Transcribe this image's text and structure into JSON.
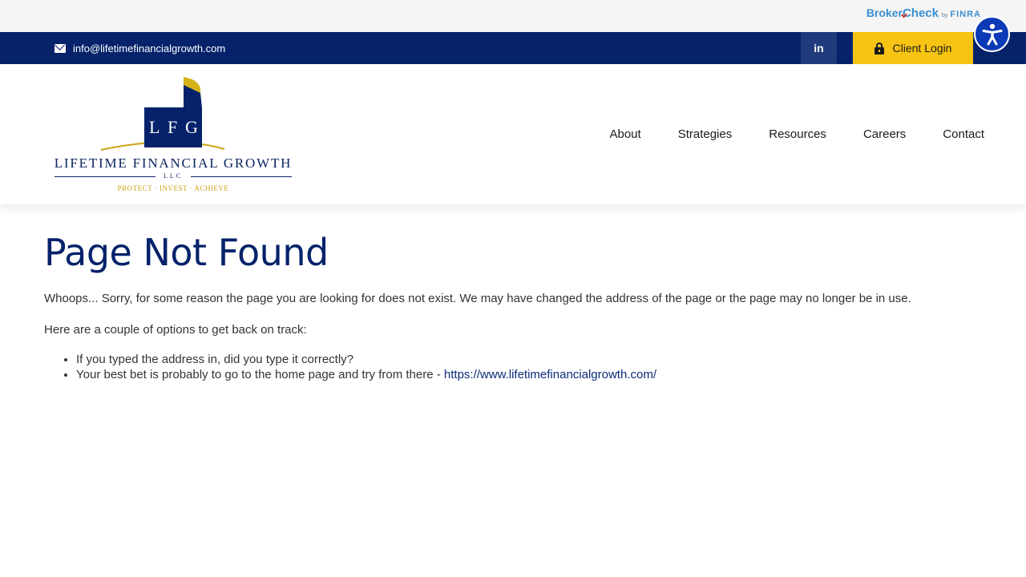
{
  "brokercheck": {
    "broker": "Broker",
    "check": "Check",
    "by": "by",
    "finra": "FINRA"
  },
  "topbar": {
    "email": "info@lifetimefinancialgrowth.com",
    "linkedin_label": "in",
    "client_login": "Client Login"
  },
  "logo": {
    "letters": [
      "L",
      "F",
      "G"
    ],
    "name": "LIFETIME FINANCIAL GROWTH",
    "llc": "LLC",
    "tagline": "PROTECT · INVEST · ACHIEVE"
  },
  "nav": {
    "items": [
      "About",
      "Strategies",
      "Resources",
      "Careers",
      "Contact"
    ]
  },
  "main": {
    "title": "Page Not Found",
    "intro": "Whoops... Sorry, for some reason the page you are looking for does not exist. We may have changed the address of the page or the page may no longer be in use.",
    "options_heading": "Here are a couple of options to get back on track:",
    "tip1": "If you typed the address in, did you type it correctly?",
    "tip2": "Your best bet is probably to go to the home page and try from there - ",
    "home_link": "https://www.lifetimefinancialgrowth.com/"
  },
  "colors": {
    "navy": "#05226a",
    "gold": "#f7c413",
    "accessibility_blue": "#0c39b6"
  },
  "icons": [
    "envelope-icon",
    "lock-icon",
    "accessibility-icon"
  ]
}
